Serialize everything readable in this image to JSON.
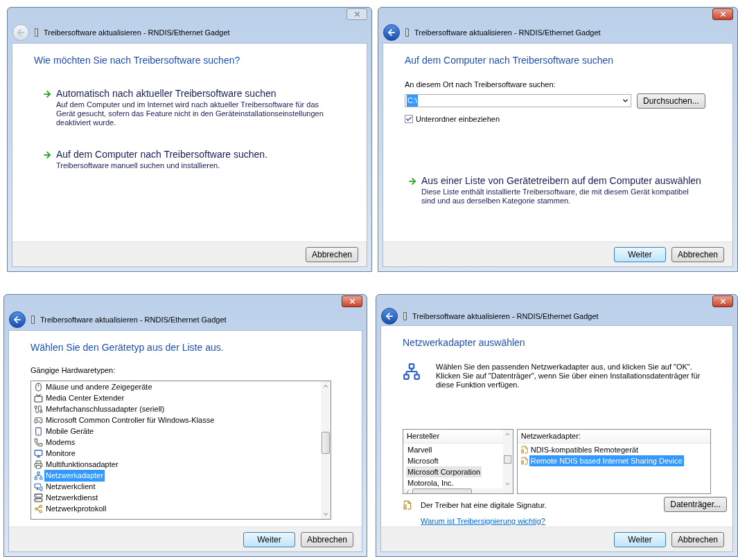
{
  "windows": [
    {
      "kind": "choose_method",
      "active": false,
      "title": "Treibersoftware aktualisieren - RNDIS/Ethernet Gadget",
      "heading": "Wie möchten Sie nach Treibersoftware suchen?",
      "options": [
        {
          "title": "Automatisch nach aktueller Treibersoftware suchen",
          "description": "Auf dem Computer und im Internet wird nach aktueller Treibersoftware für das Gerät gesucht, sofern das Feature nicht in den Geräteinstallationseinstellungen deaktiviert wurde."
        },
        {
          "title": "Auf dem Computer nach Treibersoftware suchen.",
          "description": "Treibersoftware manuell suchen und installieren."
        }
      ],
      "buttons": [
        {
          "label": "Abbrechen",
          "default": false
        }
      ]
    },
    {
      "kind": "browse",
      "active": true,
      "title": "Treibersoftware aktualisieren - RNDIS/Ethernet Gadget",
      "heading": "Auf dem Computer nach Treibersoftware suchen",
      "location_label": "An diesem Ort nach Treibersoftware suchen:",
      "location_value": "C:\\",
      "value_selected": true,
      "browse_button": "Durchsuchen...",
      "subfolders": {
        "label": "Unterordner einbeziehen",
        "checked": true
      },
      "options": [
        {
          "title": "Aus einer Liste von Gerätetreibern auf dem Computer auswählen",
          "description": "Diese Liste enthält installierte Treibersoftware, die mit diesem Gerät kompatibel sind und aus derselben Kategorie stammen."
        }
      ],
      "buttons": [
        {
          "label": "Weiter",
          "default": true
        },
        {
          "label": "Abbrechen",
          "default": false
        }
      ]
    },
    {
      "kind": "device_type",
      "active": true,
      "title": "Treibersoftware aktualisieren - RNDIS/Ethernet Gadget",
      "heading": "Wählen Sie den Gerätetyp aus der Liste aus.",
      "list_label": "Gängige Hardwaretypen:",
      "list_focused": true,
      "items": [
        {
          "label": "Mäuse und andere Zeigegeräte",
          "selected": false
        },
        {
          "label": "Media Center Extender",
          "selected": false
        },
        {
          "label": "Mehrfachanschlussadapter (seriell)",
          "selected": false
        },
        {
          "label": "Microsoft Common Controller für Windows-Klasse",
          "selected": false
        },
        {
          "label": "Mobile Geräte",
          "selected": false
        },
        {
          "label": "Modems",
          "selected": false
        },
        {
          "label": "Monitore",
          "selected": false
        },
        {
          "label": "Multifunktionsadapter",
          "selected": false
        },
        {
          "label": "Netzwerkadapter",
          "selected": true
        },
        {
          "label": "Netzwerkclient",
          "selected": false
        },
        {
          "label": "Netzwerkdienst",
          "selected": false
        },
        {
          "label": "Netzwerkprotokoll",
          "selected": false
        }
      ],
      "buttons": [
        {
          "label": "Weiter",
          "default": true
        },
        {
          "label": "Abbrechen",
          "default": false
        }
      ]
    },
    {
      "kind": "adapter",
      "active": true,
      "title": "Treibersoftware aktualisieren - RNDIS/Ethernet Gadget",
      "heading": "Netzwerkadapter auswählen",
      "intro": "Wählen Sie den passenden Netzwerkadapter aus, und klicken Sie auf \"OK\". Klicken Sie auf \"Datenträger\", wenn Sie über einen Installationsdatenträger für diese Funktion verfügen.",
      "manufacturers": {
        "header": "Hersteller",
        "focused": false,
        "items": [
          {
            "label": "Marvell",
            "selected": false
          },
          {
            "label": "Microsoft",
            "selected": false
          },
          {
            "label": "Microsoft Corporation",
            "selected": true
          },
          {
            "label": "Motorola, Inc.",
            "selected": false
          }
        ]
      },
      "adapters": {
        "header": "Netzwerkadapter:",
        "focused": true,
        "items": [
          {
            "label": "NDIS-kompatibles Remotegerät",
            "selected": false
          },
          {
            "label": "Remote NDIS based Internet Sharing Device",
            "selected": true
          }
        ]
      },
      "signature": "Der Treiber hat eine digitale Signatur.",
      "link": "Warum ist Treibersignierung wichtig?",
      "disk_button": "Datenträger...",
      "buttons": [
        {
          "label": "Weiter",
          "default": true
        },
        {
          "label": "Abbrechen",
          "default": false
        }
      ]
    }
  ]
}
